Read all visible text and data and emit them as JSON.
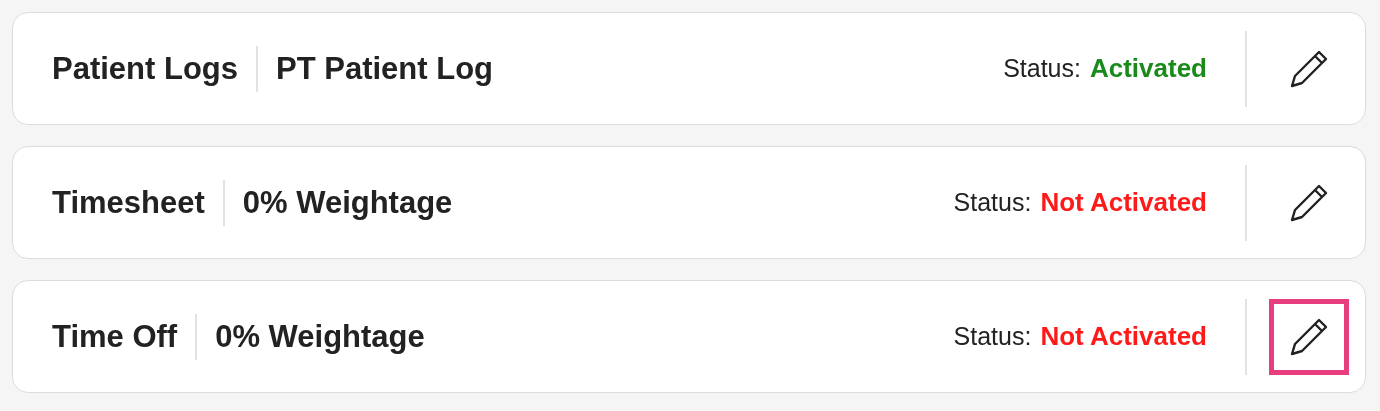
{
  "modules": [
    {
      "name": "Patient Logs",
      "detail": "PT Patient Log",
      "status_label": "Status:",
      "status": "Activated",
      "activated": true,
      "highlighted": false
    },
    {
      "name": "Timesheet",
      "detail": "0% Weightage",
      "status_label": "Status:",
      "status": "Not Activated",
      "activated": false,
      "highlighted": false
    },
    {
      "name": "Time Off",
      "detail": "0% Weightage",
      "status_label": "Status:",
      "status": "Not Activated",
      "activated": false,
      "highlighted": true
    }
  ]
}
